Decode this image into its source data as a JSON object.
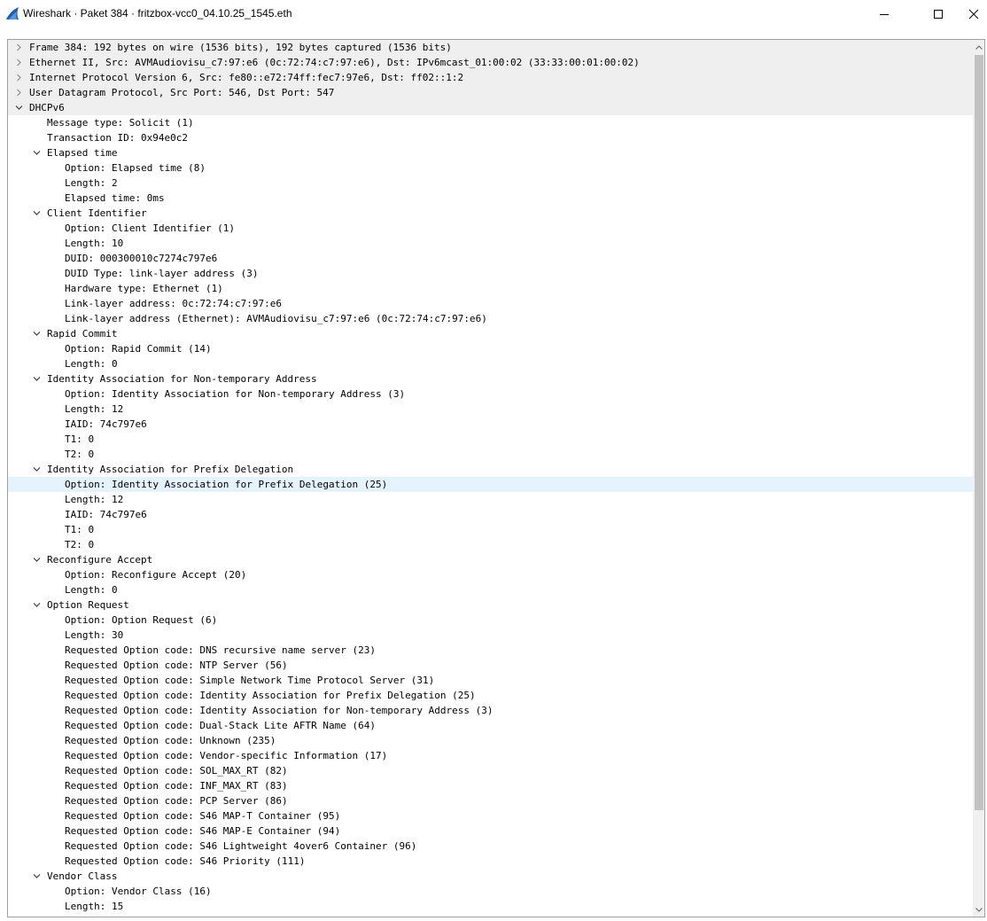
{
  "window": {
    "title": "Wireshark · Paket 384 · fritzbox-vcc0_04.10.25_1545.eth",
    "app_icon": "wireshark-fin-icon",
    "accent": "#1b5fb5"
  },
  "tree": {
    "rows": [
      {
        "text": "Frame 384: 192 bytes on wire (1536 bits), 192 bytes captured (1536 bits)",
        "level": 0,
        "state": "collapsed",
        "shaded": true
      },
      {
        "text": "Ethernet II, Src: AVMAudiovisu_c7:97:e6 (0c:72:74:c7:97:e6), Dst: IPv6mcast_01:00:02 (33:33:00:01:00:02)",
        "level": 0,
        "state": "collapsed",
        "shaded": true
      },
      {
        "text": "Internet Protocol Version 6, Src: fe80::e72:74ff:fec7:97e6, Dst: ff02::1:2",
        "level": 0,
        "state": "collapsed",
        "shaded": true
      },
      {
        "text": "User Datagram Protocol, Src Port: 546, Dst Port: 547",
        "level": 0,
        "state": "collapsed",
        "shaded": true
      },
      {
        "text": "DHCPv6",
        "level": 0,
        "state": "expanded",
        "shaded": true
      },
      {
        "text": "Message type: Solicit (1)",
        "level": 1,
        "state": "leaf"
      },
      {
        "text": "Transaction ID: 0x94e0c2",
        "level": 1,
        "state": "leaf"
      },
      {
        "text": "Elapsed time",
        "level": 1,
        "state": "expanded"
      },
      {
        "text": "Option: Elapsed time (8)",
        "level": 2,
        "state": "leaf"
      },
      {
        "text": "Length: 2",
        "level": 2,
        "state": "leaf"
      },
      {
        "text": "Elapsed time: 0ms",
        "level": 2,
        "state": "leaf"
      },
      {
        "text": "Client Identifier",
        "level": 1,
        "state": "expanded"
      },
      {
        "text": "Option: Client Identifier (1)",
        "level": 2,
        "state": "leaf"
      },
      {
        "text": "Length: 10",
        "level": 2,
        "state": "leaf"
      },
      {
        "text": "DUID: 000300010c7274c797e6",
        "level": 2,
        "state": "leaf"
      },
      {
        "text": "DUID Type: link-layer address (3)",
        "level": 2,
        "state": "leaf"
      },
      {
        "text": "Hardware type: Ethernet (1)",
        "level": 2,
        "state": "leaf"
      },
      {
        "text": "Link-layer address: 0c:72:74:c7:97:e6",
        "level": 2,
        "state": "leaf"
      },
      {
        "text": "Link-layer address (Ethernet): AVMAudiovisu_c7:97:e6 (0c:72:74:c7:97:e6)",
        "level": 2,
        "state": "leaf"
      },
      {
        "text": "Rapid Commit",
        "level": 1,
        "state": "expanded"
      },
      {
        "text": "Option: Rapid Commit (14)",
        "level": 2,
        "state": "leaf"
      },
      {
        "text": "Length: 0",
        "level": 2,
        "state": "leaf"
      },
      {
        "text": "Identity Association for Non-temporary Address",
        "level": 1,
        "state": "expanded"
      },
      {
        "text": "Option: Identity Association for Non-temporary Address (3)",
        "level": 2,
        "state": "leaf"
      },
      {
        "text": "Length: 12",
        "level": 2,
        "state": "leaf"
      },
      {
        "text": "IAID: 74c797e6",
        "level": 2,
        "state": "leaf"
      },
      {
        "text": "T1: 0",
        "level": 2,
        "state": "leaf"
      },
      {
        "text": "T2: 0",
        "level": 2,
        "state": "leaf"
      },
      {
        "text": "Identity Association for Prefix Delegation",
        "level": 1,
        "state": "expanded"
      },
      {
        "text": "Option: Identity Association for Prefix Delegation (25)",
        "level": 2,
        "state": "leaf",
        "selected": true
      },
      {
        "text": "Length: 12",
        "level": 2,
        "state": "leaf"
      },
      {
        "text": "IAID: 74c797e6",
        "level": 2,
        "state": "leaf"
      },
      {
        "text": "T1: 0",
        "level": 2,
        "state": "leaf"
      },
      {
        "text": "T2: 0",
        "level": 2,
        "state": "leaf"
      },
      {
        "text": "Reconfigure Accept",
        "level": 1,
        "state": "expanded"
      },
      {
        "text": "Option: Reconfigure Accept (20)",
        "level": 2,
        "state": "leaf"
      },
      {
        "text": "Length: 0",
        "level": 2,
        "state": "leaf"
      },
      {
        "text": "Option Request",
        "level": 1,
        "state": "expanded"
      },
      {
        "text": "Option: Option Request (6)",
        "level": 2,
        "state": "leaf"
      },
      {
        "text": "Length: 30",
        "level": 2,
        "state": "leaf"
      },
      {
        "text": "Requested Option code: DNS recursive name server (23)",
        "level": 2,
        "state": "leaf"
      },
      {
        "text": "Requested Option code: NTP Server (56)",
        "level": 2,
        "state": "leaf"
      },
      {
        "text": "Requested Option code: Simple Network Time Protocol Server (31)",
        "level": 2,
        "state": "leaf"
      },
      {
        "text": "Requested Option code: Identity Association for Prefix Delegation (25)",
        "level": 2,
        "state": "leaf"
      },
      {
        "text": "Requested Option code: Identity Association for Non-temporary Address (3)",
        "level": 2,
        "state": "leaf"
      },
      {
        "text": "Requested Option code: Dual-Stack Lite AFTR Name (64)",
        "level": 2,
        "state": "leaf"
      },
      {
        "text": "Requested Option code: Unknown (235)",
        "level": 2,
        "state": "leaf"
      },
      {
        "text": "Requested Option code: Vendor-specific Information (17)",
        "level": 2,
        "state": "leaf"
      },
      {
        "text": "Requested Option code: SOL_MAX_RT (82)",
        "level": 2,
        "state": "leaf"
      },
      {
        "text": "Requested Option code: INF_MAX_RT (83)",
        "level": 2,
        "state": "leaf"
      },
      {
        "text": "Requested Option code: PCP Server (86)",
        "level": 2,
        "state": "leaf"
      },
      {
        "text": "Requested Option code: S46 MAP-T Container (95)",
        "level": 2,
        "state": "leaf"
      },
      {
        "text": "Requested Option code: S46 MAP-E Container (94)",
        "level": 2,
        "state": "leaf"
      },
      {
        "text": "Requested Option code: S46 Lightweight 4over6 Container (96)",
        "level": 2,
        "state": "leaf"
      },
      {
        "text": "Requested Option code: S46 Priority (111)",
        "level": 2,
        "state": "leaf"
      },
      {
        "text": "Vendor Class",
        "level": 1,
        "state": "expanded"
      },
      {
        "text": "Option: Vendor Class (16)",
        "level": 2,
        "state": "leaf"
      },
      {
        "text": "Length: 15",
        "level": 2,
        "state": "leaf"
      }
    ]
  }
}
